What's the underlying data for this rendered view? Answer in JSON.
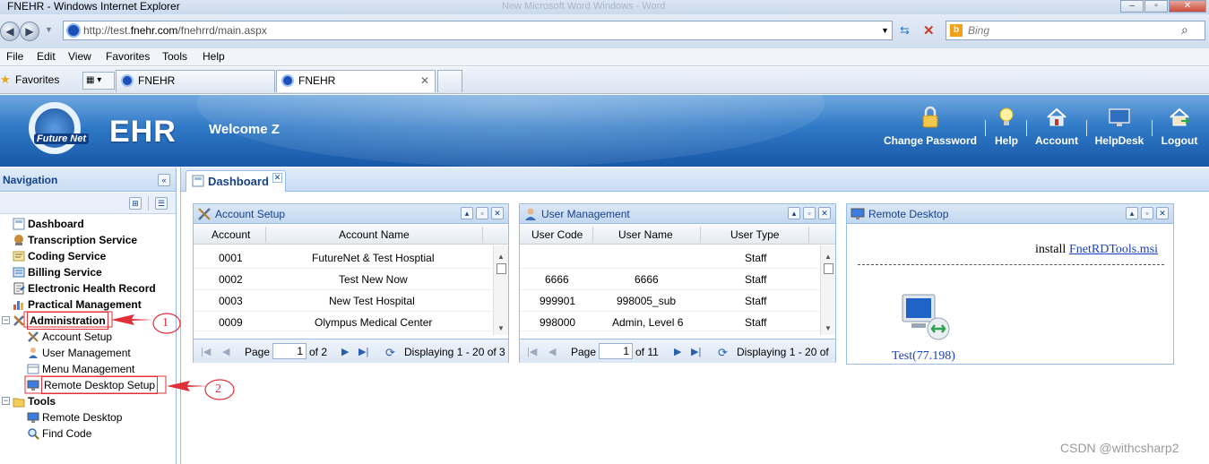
{
  "browser": {
    "window_title": "FNEHR - Windows Internet Explorer",
    "ghost_title": "New Microsoft Word Windows - Word",
    "url_host_prefix": "http://test.",
    "url_host": "fnehr.com",
    "url_path": "/fnehrrd/main.aspx",
    "search_placeholder": "Bing",
    "menu": [
      "File",
      "Edit",
      "View",
      "Favorites",
      "Tools",
      "Help"
    ],
    "favorites_label": "Favorites",
    "tabs": [
      {
        "label": "FNEHR",
        "active": false
      },
      {
        "label": "FNEHR",
        "active": true
      }
    ]
  },
  "header": {
    "logo_text": "Future Net",
    "app_name": "EHR",
    "welcome": "Welcome Z",
    "tools": [
      {
        "label": "Change Password",
        "icon": "lock-icon"
      },
      {
        "label": "Help",
        "icon": "lightbulb-icon"
      },
      {
        "label": "Account",
        "icon": "home-icon"
      },
      {
        "label": "HelpDesk",
        "icon": "monitor-icon"
      },
      {
        "label": "Logout",
        "icon": "logout-house-icon"
      }
    ]
  },
  "navigation": {
    "title": "Navigation",
    "items": [
      {
        "label": "Dashboard",
        "level": 0,
        "bold": true
      },
      {
        "label": "Transcription Service",
        "level": 0,
        "bold": true
      },
      {
        "label": "Coding Service",
        "level": 0,
        "bold": true
      },
      {
        "label": "Billing Service",
        "level": 0,
        "bold": true
      },
      {
        "label": "Electronic Health Record",
        "level": 0,
        "bold": true
      },
      {
        "label": "Practical Management",
        "level": 0,
        "bold": true
      },
      {
        "label": "Administration",
        "level": 0,
        "bold": true
      },
      {
        "label": "Account Setup",
        "level": 1,
        "bold": false
      },
      {
        "label": "User Management",
        "level": 1,
        "bold": false
      },
      {
        "label": "Menu Management",
        "level": 1,
        "bold": false
      },
      {
        "label": "Remote Desktop Setup",
        "level": 1,
        "bold": false
      },
      {
        "label": "Tools",
        "level": 0,
        "bold": true
      },
      {
        "label": "Remote Desktop",
        "level": 1,
        "bold": false
      },
      {
        "label": "Find Code",
        "level": 1,
        "bold": false
      }
    ]
  },
  "main": {
    "tab_label": "Dashboard",
    "account_setup": {
      "title": "Account Setup",
      "columns": [
        "Account",
        "Account Name"
      ],
      "rows": [
        [
          "0001",
          "FutureNet & Test Hosptial"
        ],
        [
          "0002",
          "Test New Now"
        ],
        [
          "0003",
          "New Test Hospital"
        ],
        [
          "0009",
          "Olympus Medical Center"
        ]
      ],
      "page_label": "Page",
      "page_value": "1",
      "of_pages": "of 2",
      "displaying": "Displaying 1 - 20 of 3"
    },
    "user_management": {
      "title": "User Management",
      "columns": [
        "User Code",
        "User Name",
        "User Type"
      ],
      "rows": [
        [
          "",
          "",
          "Staff"
        ],
        [
          "6666",
          "6666",
          "Staff"
        ],
        [
          "999901",
          "998005_sub",
          "Staff"
        ],
        [
          "998000",
          "Admin, Level 6",
          "Staff"
        ]
      ],
      "page_label": "Page",
      "page_value": "1",
      "of_pages": "of 11",
      "displaying": "Displaying 1 - 20 of"
    },
    "remote_desktop": {
      "title": "Remote Desktop",
      "install_text": "install",
      "install_link": "FnetRDTools.msi",
      "item_label": "Test(77.198)"
    }
  },
  "annotations": {
    "marker1": "1",
    "marker2": "2",
    "color": "#e0303a"
  },
  "watermark": "CSDN @withcsharp2"
}
